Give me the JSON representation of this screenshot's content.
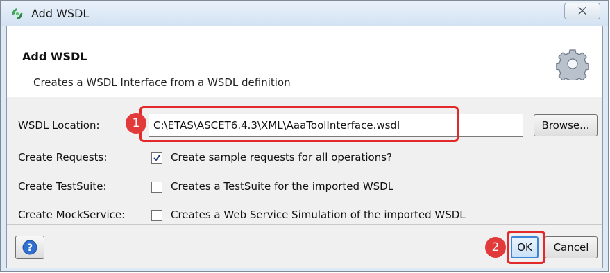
{
  "window": {
    "title": "Add WSDL",
    "close_glyph": "⨉"
  },
  "header": {
    "title": "Add WSDL",
    "description": "Creates a WSDL Interface from a WSDL definition",
    "icon": "gear-icon"
  },
  "form": {
    "wsdl_location": {
      "label": "WSDL Location:",
      "value": "C:\\ETAS\\ASCET6.4.3\\XML\\AaaToolInterface.wsdl",
      "browse_label": "Browse..."
    },
    "create_requests": {
      "label": "Create Requests:",
      "checked": true,
      "text": "Create sample requests for all operations?"
    },
    "create_testsuite": {
      "label": "Create TestSuite:",
      "checked": false,
      "text": "Creates a TestSuite for the imported WSDL"
    },
    "create_mockservice": {
      "label": "Create MockService:",
      "checked": false,
      "text": "Creates a Web Service Simulation of the imported WSDL"
    }
  },
  "footer": {
    "ok_label": "OK",
    "cancel_label": "Cancel",
    "help_icon": "help-icon"
  },
  "annotations": [
    {
      "number": "1",
      "target": "wsdl-location-input"
    },
    {
      "number": "2",
      "target": "ok-button"
    }
  ],
  "colors": {
    "annotation": "#e23a3a",
    "accent": "#3b86d6",
    "title_bar": "#d3e2f2"
  }
}
